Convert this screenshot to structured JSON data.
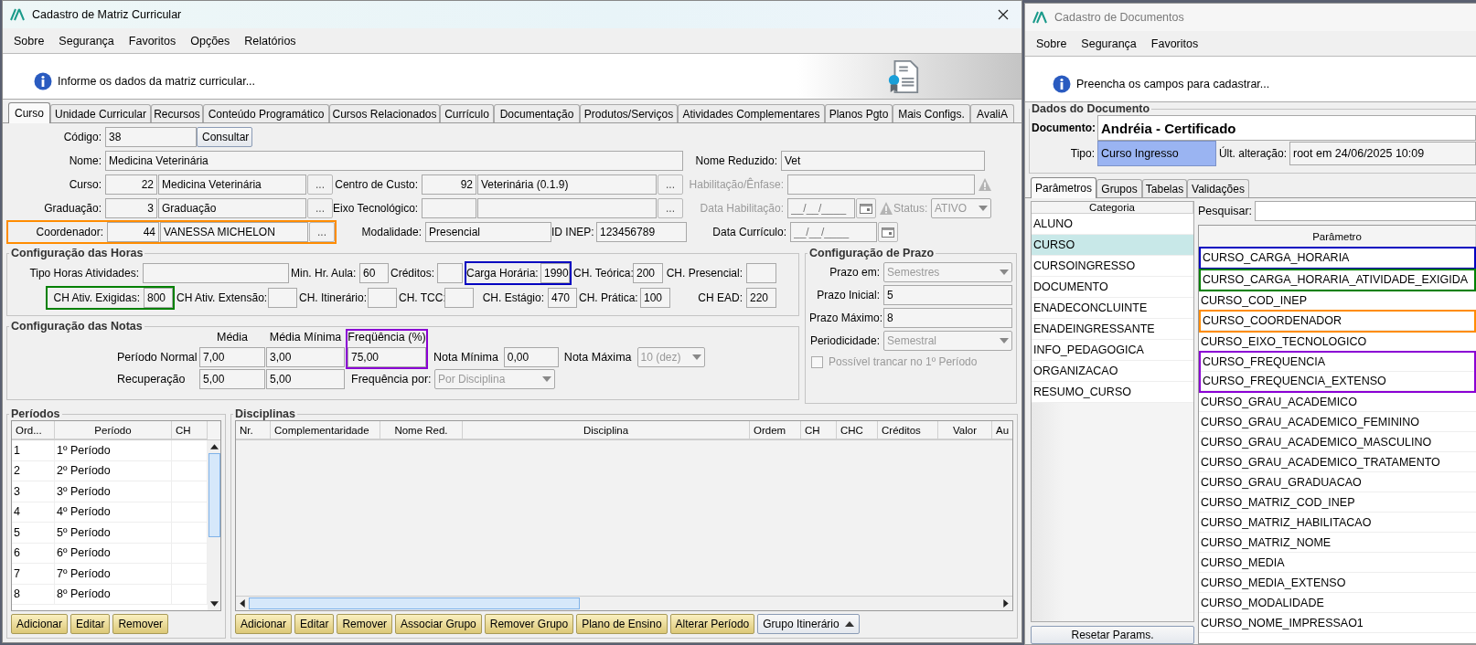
{
  "left_window": {
    "title": "Cadastro de Matriz Curricular",
    "menu": [
      "Sobre",
      "Segurança",
      "Favoritos",
      "Opções",
      "Relatórios"
    ],
    "info": "Informe os dados da matriz curricular...",
    "tabs": [
      {
        "label": "Curso",
        "selected": true
      },
      {
        "label": "Unidade Curricular",
        "selected": false
      },
      {
        "label": "Recursos",
        "selected": false
      },
      {
        "label": "Conteúdo Programático",
        "selected": false
      },
      {
        "label": "Cursos Relacionados",
        "selected": false
      },
      {
        "label": "Currículo",
        "selected": false
      },
      {
        "label": "Documentação",
        "selected": false
      },
      {
        "label": "Produtos/Serviços",
        "selected": false
      },
      {
        "label": "Atividades Complementares",
        "selected": false
      },
      {
        "label": "Planos Pgto",
        "selected": false
      },
      {
        "label": "Mais Configs.",
        "selected": false
      },
      {
        "label": "AvaliA",
        "selected": false
      }
    ],
    "course_rows": [
      [
        {
          "kind": "field",
          "label": "Código:",
          "value": "38"
        },
        {
          "kind": "button",
          "label": "Consultar"
        }
      ],
      [
        {
          "kind": "field",
          "label": "Nome:",
          "value": "Medicina Veterinária"
        },
        {
          "kind": "field",
          "label": "Nome Reduzido:",
          "value": "Vet"
        }
      ],
      [
        {
          "kind": "lookup",
          "label": "Curso:",
          "code": "22",
          "value": "Medicina Veterinária",
          "button": "..."
        },
        {
          "kind": "lookup",
          "label": "Centro de Custo:",
          "code": "92",
          "value": "Veterinária (0.1.9)",
          "button": "..."
        },
        {
          "kind": "field",
          "label": "Habilitação/Ênfase:",
          "disabled": true,
          "warning": true
        }
      ],
      [
        {
          "kind": "lookup",
          "label": "Graduação:",
          "code": "3",
          "value": "Graduação",
          "button": "..."
        },
        {
          "kind": "lookup",
          "label": "Eixo Tecnológico:",
          "button": "..."
        },
        {
          "kind": "date",
          "label": "Data Habilitação:",
          "placeholder": "__/__/____",
          "disabled": true,
          "warning": true
        },
        {
          "kind": "select",
          "label": "Status:",
          "value": "ATIVO",
          "disabled": true
        }
      ],
      [
        {
          "kind": "lookup",
          "label": "Coordenador:",
          "code": "44",
          "value": "VANESSA MICHELON",
          "button": "...",
          "color": "#ff8c00"
        },
        {
          "kind": "field",
          "label": "Modalidade:",
          "value": "Presencial"
        },
        {
          "kind": "field",
          "label": "ID INEP:",
          "value": "123456789"
        },
        {
          "kind": "date",
          "label": "Data Currículo:",
          "placeholder": "__/__/____",
          "disabled": false
        }
      ]
    ],
    "hours": {
      "title": "Configuração das Horas",
      "fields": [
        {
          "label": "Tipo Horas Atividades:"
        },
        {
          "label": "Min. Hr. Aula:",
          "value": "60"
        },
        {
          "label": "Créditos:"
        },
        {
          "label": "Carga Horária:",
          "value": "1990",
          "color": "#0000c0"
        },
        {
          "label": "CH. Teórica:",
          "value": "200"
        },
        {
          "label": "CH. Presencial:"
        },
        {
          "label": "CH Ativ. Exigidas:",
          "value": "800",
          "color": "#008000"
        },
        {
          "label": "CH Ativ. Extensão:"
        },
        {
          "label": "CH. Itinerário:"
        },
        {
          "label": "CH. TCC:"
        },
        {
          "label": "CH. Estágio:",
          "value": "470"
        },
        {
          "label": "CH. Prática:",
          "value": "100"
        },
        {
          "label": "CH EAD:",
          "value": "220"
        }
      ]
    },
    "grades": {
      "title": "Configuração das Notas",
      "columns": [
        {
          "label": "Média"
        },
        {
          "label": "Média Mínima"
        },
        {
          "label": "Freqüência (%)",
          "color": "#8a00d4"
        }
      ],
      "rows": [
        {
          "label": "Período Normal",
          "values": [
            "7,00",
            "3,00",
            "75,00"
          ]
        },
        {
          "label": "Recuperação",
          "values": [
            "5,00",
            "5,00"
          ]
        }
      ],
      "min_grade": {
        "label": "Nota Mínima",
        "value": "0,00"
      },
      "max_grade": {
        "label": "Nota Máxima",
        "value": "10 (dez)",
        "disabled": true
      },
      "frequency_by": {
        "label": "Frequência por:",
        "value": "Por Disciplina",
        "disabled": true
      }
    },
    "deadline": {
      "title": "Configuração de Prazo",
      "rows": [
        {
          "kind": "select",
          "label": "Prazo em:",
          "value": "Semestres",
          "disabled": true
        },
        {
          "kind": "field",
          "label": "Prazo Inicial:",
          "value": "5"
        },
        {
          "kind": "field",
          "label": "Prazo Máximo:",
          "value": "8"
        },
        {
          "kind": "select",
          "label": "Periodicidade:",
          "value": "Semestral",
          "disabled": true
        }
      ],
      "lock_option": {
        "label": "Possível trancar no 1º Período",
        "checked": false,
        "disabled": true
      }
    },
    "periods": {
      "title": "Períodos",
      "columns": [
        "Ord...",
        "Período",
        "CH"
      ],
      "rows": [
        {
          "order": "1",
          "name": "1º Período"
        },
        {
          "order": "2",
          "name": "2º Período"
        },
        {
          "order": "3",
          "name": "3º Período"
        },
        {
          "order": "4",
          "name": "4º Período"
        },
        {
          "order": "5",
          "name": "5º Período"
        },
        {
          "order": "6",
          "name": "6º Período"
        },
        {
          "order": "7",
          "name": "7º Período"
        },
        {
          "order": "8",
          "name": "8º Período"
        }
      ],
      "buttons": [
        "Adicionar",
        "Editar",
        "Remover"
      ]
    },
    "subjects": {
      "title": "Disciplinas",
      "columns": [
        "Nr.",
        "Complementaridade",
        "Nome Red.",
        "Disciplina",
        "Ordem",
        "CH",
        "CHC",
        "Créditos",
        "Valor",
        "Au"
      ],
      "buttons": [
        {
          "label": "Adicionar",
          "kind": "action"
        },
        {
          "label": "Editar",
          "kind": "action"
        },
        {
          "label": "Remover",
          "kind": "action"
        },
        {
          "label": "Associar Grupo",
          "kind": "action"
        },
        {
          "label": "Remover Grupo",
          "kind": "action"
        },
        {
          "label": "Plano de Ensino",
          "kind": "action"
        },
        {
          "label": "Alterar Período",
          "kind": "action"
        },
        {
          "label": "Grupo Itinerário",
          "kind": "dropdown"
        }
      ]
    }
  },
  "right_window": {
    "title": "Cadastro de Documentos",
    "menu": [
      "Sobre",
      "Segurança",
      "Favoritos"
    ],
    "info": "Preencha os campos para cadastrar...",
    "group_title": "Dados do Documento",
    "document": {
      "label": "Documento:",
      "value": "Andréia - Certificado"
    },
    "type": {
      "label": "Tipo:",
      "value": "Curso Ingresso"
    },
    "last_change": {
      "label": "Últ. alteração:",
      "value": "root em 24/06/2025 10:09"
    },
    "tabs": [
      {
        "label": "Parâmetros",
        "selected": true
      },
      {
        "label": "Grupos",
        "selected": false
      },
      {
        "label": "Tabelas",
        "selected": false
      },
      {
        "label": "Validações",
        "selected": false
      }
    ],
    "category_header": "Categoria",
    "categories": [
      {
        "label": "ALUNO",
        "selected": false
      },
      {
        "label": "CURSO",
        "selected": true
      },
      {
        "label": "CURSOINGRESSO",
        "selected": false
      },
      {
        "label": "DOCUMENTO",
        "selected": false
      },
      {
        "label": "ENADECONCLUINTE",
        "selected": false
      },
      {
        "label": "ENADEINGRESSANTE",
        "selected": false
      },
      {
        "label": "INFO_PEDAGOGICA",
        "selected": false
      },
      {
        "label": "ORGANIZACAO",
        "selected": false
      },
      {
        "label": "RESUMO_CURSO",
        "selected": false
      }
    ],
    "reset_button": "Resetar Params.",
    "search_label": "Pesquisar:",
    "param_header": "Parâmetro",
    "params": [
      {
        "label": "CURSO_CARGA_HORARIA",
        "color": "#0000c0"
      },
      {
        "label": "CURSO_CARGA_HORARIA_ATIVIDADE_EXIGIDA",
        "color": "#008000"
      },
      {
        "label": "CURSO_COD_INEP"
      },
      {
        "label": "CURSO_COORDENADOR",
        "color": "#ff8c00"
      },
      {
        "label": "CURSO_EIXO_TECNOLOGICO"
      },
      {
        "label": "CURSO_FREQUENCIA",
        "color": "#8a00d4"
      },
      {
        "label": "CURSO_FREQUENCIA_EXTENSO",
        "color": "#8a00d4"
      },
      {
        "label": "CURSO_GRAU_ACADEMICO"
      },
      {
        "label": "CURSO_GRAU_ACADEMICO_FEMININO"
      },
      {
        "label": "CURSO_GRAU_ACADEMICO_MASCULINO"
      },
      {
        "label": "CURSO_GRAU_ACADEMICO_TRATAMENTO"
      },
      {
        "label": "CURSO_GRAU_GRADUACAO"
      },
      {
        "label": "CURSO_MATRIZ_COD_INEP"
      },
      {
        "label": "CURSO_MATRIZ_HABILITACAO"
      },
      {
        "label": "CURSO_MATRIZ_NOME"
      },
      {
        "label": "CURSO_MEDIA"
      },
      {
        "label": "CURSO_MEDIA_EXTENSO"
      },
      {
        "label": "CURSO_MODALIDADE"
      },
      {
        "label": "CURSO_NOME_IMPRESSAO1"
      }
    ]
  }
}
